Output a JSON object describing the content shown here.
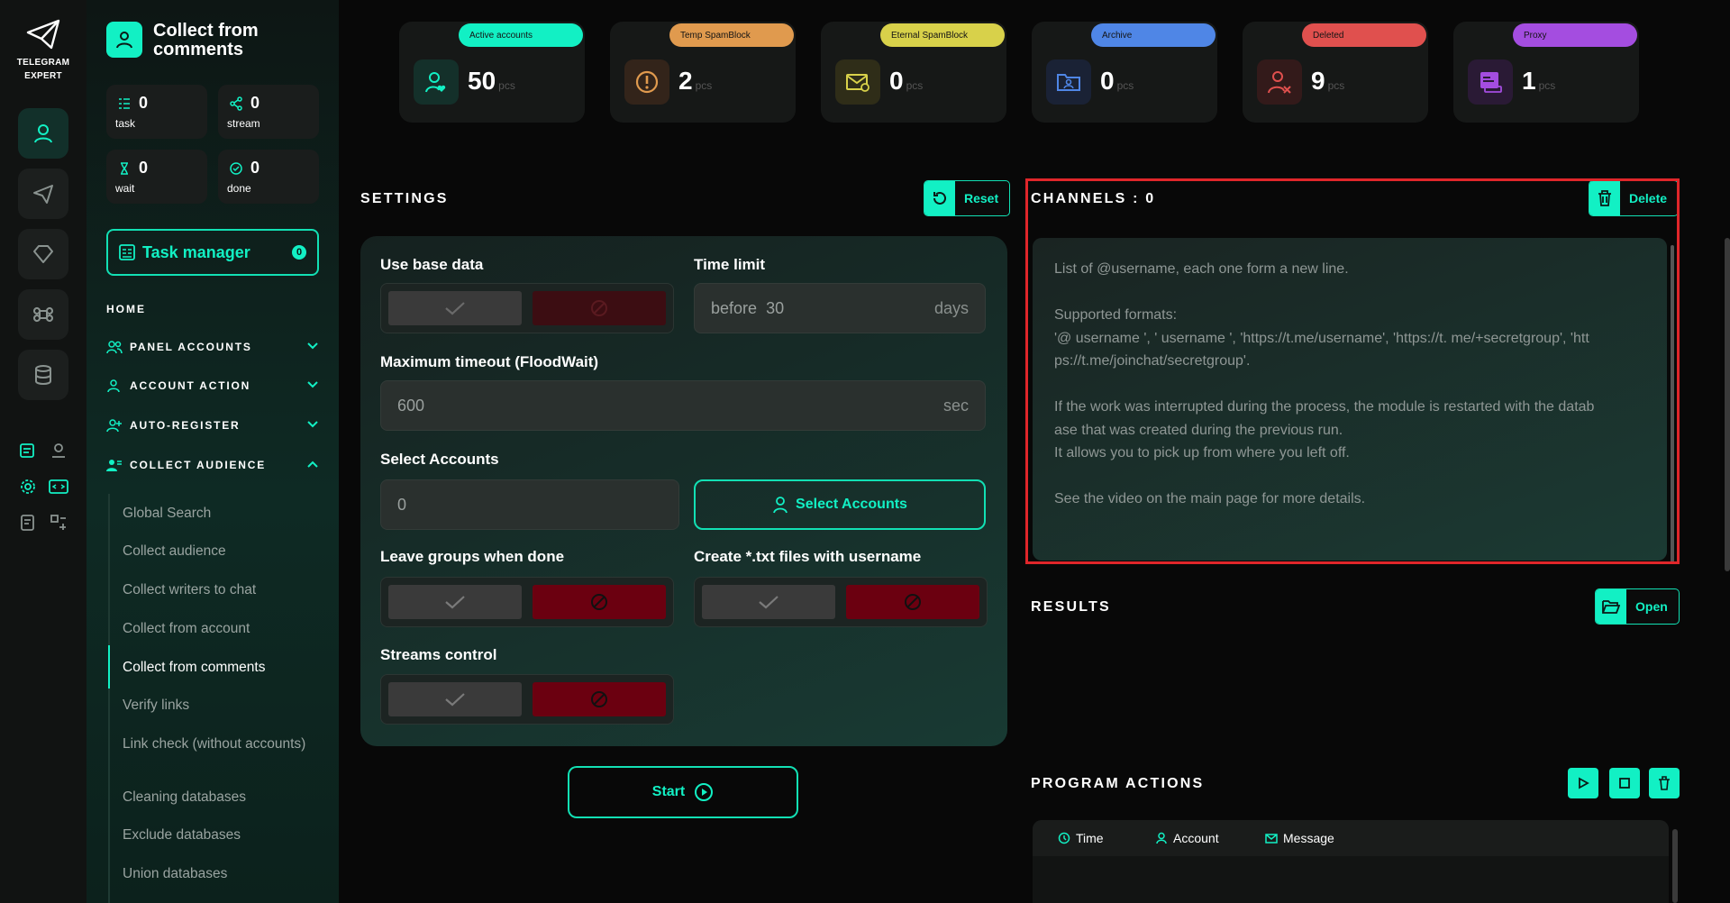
{
  "brand": {
    "line1": "TELEGRAM",
    "line2": "EXPERT"
  },
  "sidebar": {
    "title": "Collect from comments",
    "stats": [
      {
        "value": "0",
        "label": "task"
      },
      {
        "value": "0",
        "label": "stream"
      },
      {
        "value": "0",
        "label": "wait"
      },
      {
        "value": "0",
        "label": "done"
      }
    ],
    "task_manager": {
      "label": "Task manager",
      "count": "0"
    },
    "home": "HOME",
    "sections": [
      "PANEL ACCOUNTS",
      "ACCOUNT ACTION",
      "AUTO-REGISTER",
      "COLLECT AUDIENCE"
    ],
    "subitems": [
      "Global Search",
      "Collect audience",
      "Collect writers to chat",
      "Collect from account",
      "Collect from comments",
      "Verify links",
      "Link check (without accounts)",
      "Cleaning databases",
      "Exclude databases",
      "Union databases"
    ]
  },
  "cards": [
    {
      "tag": "Active accounts",
      "value": "50",
      "unit": "pcs",
      "color": "#12f0c4"
    },
    {
      "tag": "Temp SpamBlock",
      "value": "2",
      "unit": "pcs",
      "color": "#e09a4e"
    },
    {
      "tag": "Eternal SpamBlock",
      "value": "0",
      "unit": "pcs",
      "color": "#d8d14a"
    },
    {
      "tag": "Archive",
      "value": "0",
      "unit": "pcs",
      "color": "#4f86e6"
    },
    {
      "tag": "Deleted",
      "value": "9",
      "unit": "pcs",
      "color": "#e0504e"
    },
    {
      "tag": "Proxy",
      "value": "1",
      "unit": "pcs",
      "color": "#a44de0"
    }
  ],
  "settings": {
    "title": "SETTINGS",
    "reset": "Reset",
    "use_base_data": "Use base data",
    "time_limit": "Time limit",
    "time_before": "before",
    "time_value": "30",
    "time_unit": "days",
    "max_timeout": "Maximum timeout (FloodWait)",
    "timeout_value": "600",
    "timeout_unit": "sec",
    "select_accounts": "Select Accounts",
    "accounts_value": "0",
    "select_button": "Select Accounts",
    "leave_groups": "Leave groups when done",
    "create_txt": "Create *.txt files with username",
    "streams_control": "Streams control",
    "start": "Start"
  },
  "channels": {
    "title": "CHANNELS : 0",
    "delete": "Delete",
    "placeholder_lines": [
      "List of @username, each one form a new line.",
      "",
      "Supported formats:",
      "'@ username ', ' username ', 'https://t.me/username', 'https://t. me/+secretgroup', 'htt",
      "ps://t.me/joinchat/secretgroup'.",
      "",
      "If the work was interrupted during the process, the module is restarted with the datab",
      "ase that was created during the previous run.",
      "It allows you to pick up from where you left off.",
      "",
      "See the video on the main page for more details."
    ]
  },
  "results": {
    "title": "RESULTS",
    "open": "Open"
  },
  "program_actions": {
    "title": "PROGRAM ACTIONS",
    "columns": [
      "Time",
      "Account",
      "Message"
    ]
  },
  "colors": {
    "accent": "#12f0c4",
    "danger": "#6b0010",
    "background": "#080808"
  }
}
